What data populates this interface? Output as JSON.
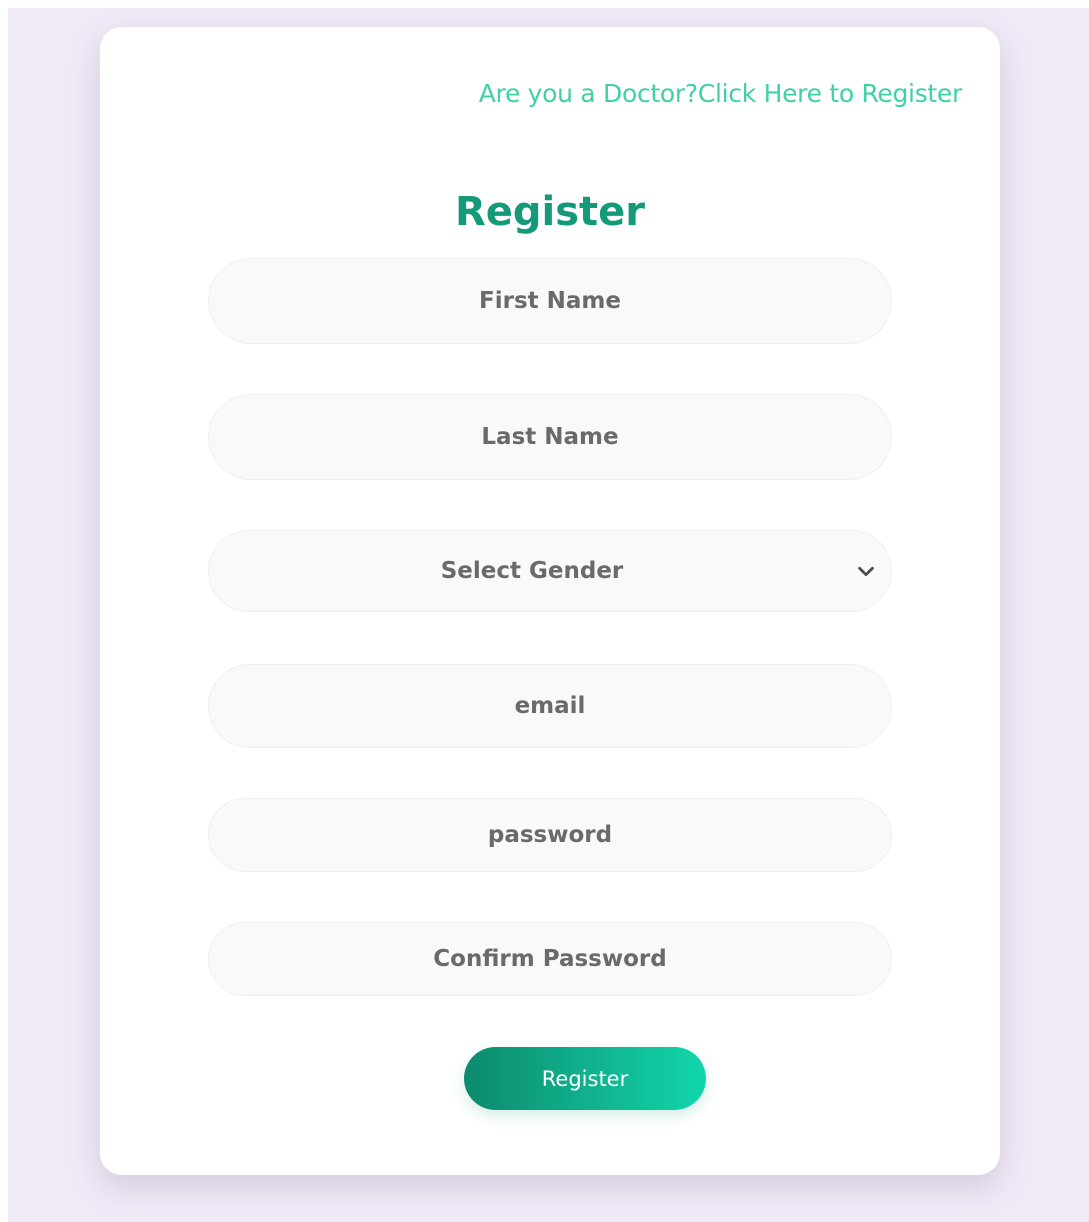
{
  "header": {
    "doctor_link": "Are you a Doctor?Click Here to Register"
  },
  "form": {
    "title": "Register",
    "first_name_placeholder": "First Name",
    "last_name_placeholder": "Last Name",
    "gender_selected": "Select Gender",
    "email_placeholder": "email",
    "password_placeholder": "password",
    "confirm_password_placeholder": "Confirm Password",
    "submit_label": "Register"
  },
  "colors": {
    "accent_link": "#3fd1a4",
    "title": "#149a79",
    "button_gradient_start": "#0e8a6d",
    "button_gradient_end": "#11d6ab",
    "page_background": "#f0e9f6"
  },
  "icons": {
    "gender_dropdown": "chevron-down-icon"
  }
}
